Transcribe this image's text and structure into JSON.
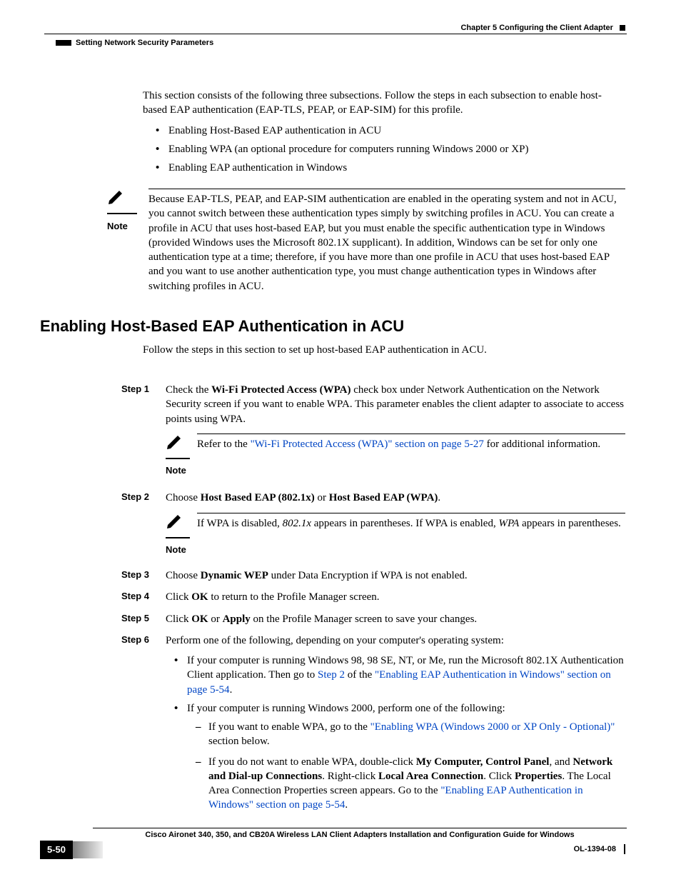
{
  "header": {
    "chapter": "Chapter 5      Configuring the Client Adapter",
    "section": "Setting Network Security Parameters"
  },
  "intro": {
    "p1": "This section consists of the following three subsections. Follow the steps in each subsection to enable host-based EAP authentication (EAP-TLS, PEAP, or EAP-SIM) for this profile.",
    "bullets": [
      "Enabling Host-Based EAP authentication in ACU",
      "Enabling WPA (an optional procedure for computers running Windows 2000 or XP)",
      "Enabling EAP authentication in Windows"
    ],
    "note_label": "Note",
    "note_body": "Because EAP-TLS, PEAP, and EAP-SIM authentication are enabled in the operating system and not in ACU, you cannot switch between these authentication types simply by switching profiles in ACU. You can create a profile in ACU that uses host-based EAP, but you must enable the specific authentication type in Windows (provided Windows uses the Microsoft 802.1X supplicant). In addition, Windows can be set for only one authentication type at a time; therefore, if you have more than one profile in ACU that uses host-based EAP and you want to use another authentication type, you must change authentication types in Windows after switching profiles in ACU."
  },
  "section_heading": "Enabling Host-Based EAP Authentication in ACU",
  "section_intro": "Follow the steps in this section to set up host-based EAP authentication in ACU.",
  "steps": {
    "s1": {
      "label": "Step 1",
      "pre": "Check the ",
      "bold1": "Wi-Fi Protected Access (WPA)",
      "post": " check box under Network Authentication on the Network Security screen if you want to enable WPA. This parameter enables the client adapter to associate to access points using WPA.",
      "note_label": "Note",
      "note_pre": "Refer to the ",
      "note_link": "\"Wi-Fi Protected Access (WPA)\" section on page 5-27",
      "note_post": " for additional information."
    },
    "s2": {
      "label": "Step 2",
      "pre": "Choose ",
      "bold1": "Host Based EAP (802.1x)",
      "mid": " or ",
      "bold2": "Host Based EAP (WPA)",
      "post": ".",
      "note_label": "Note",
      "note_pre": "If WPA is disabled, ",
      "note_it1": "802.1x",
      "note_mid": " appears in parentheses. If WPA is enabled, ",
      "note_it2": "WPA",
      "note_post": " appears in parentheses."
    },
    "s3": {
      "label": "Step 3",
      "pre": "Choose ",
      "bold1": "Dynamic WEP",
      "post": " under Data Encryption if WPA is not enabled."
    },
    "s4": {
      "label": "Step 4",
      "pre": "Click ",
      "bold1": "OK",
      "post": " to return to the Profile Manager screen."
    },
    "s5": {
      "label": "Step 5",
      "pre": "Click ",
      "bold1": "OK",
      "mid": " or ",
      "bold2": "Apply",
      "post": " on the Profile Manager screen to save your changes."
    },
    "s6": {
      "label": "Step 6",
      "intro": "Perform one of the following, depending on your computer's operating system:",
      "b1_pre": "If your computer is running Windows 98, 98 SE, NT, or Me, run the Microsoft 802.1X Authentication Client application. Then go to ",
      "b1_link1": "Step 2",
      "b1_mid": " of the ",
      "b1_link2": "\"Enabling EAP Authentication in Windows\" section on page 5-54",
      "b1_post": ".",
      "b2_intro": "If your computer is running Windows 2000, perform one of the following:",
      "b2_d1_pre": "If you want to enable WPA, go to the ",
      "b2_d1_link": "\"Enabling WPA (Windows 2000 or XP Only - Optional)\"",
      "b2_d1_post": " section below.",
      "b2_d2_pre": "If you do not want to enable WPA, double-click ",
      "b2_d2_b1": "My Computer, Control Panel",
      "b2_d2_mid1": ", and ",
      "b2_d2_b2": "Network and Dial-up Connections",
      "b2_d2_mid2": ". Right-click ",
      "b2_d2_b3": "Local Area Connection",
      "b2_d2_mid3": ". Click ",
      "b2_d2_b4": "Properties",
      "b2_d2_mid4": ". The Local Area Connection Properties screen appears. Go to the ",
      "b2_d2_link": "\"Enabling EAP Authentication in Windows\" section on page 5-54",
      "b2_d2_post": "."
    }
  },
  "footer": {
    "title": "Cisco Aironet 340, 350, and CB20A Wireless LAN Client Adapters Installation and Configuration Guide for Windows",
    "page": "5-50",
    "doc": "OL-1394-08"
  }
}
